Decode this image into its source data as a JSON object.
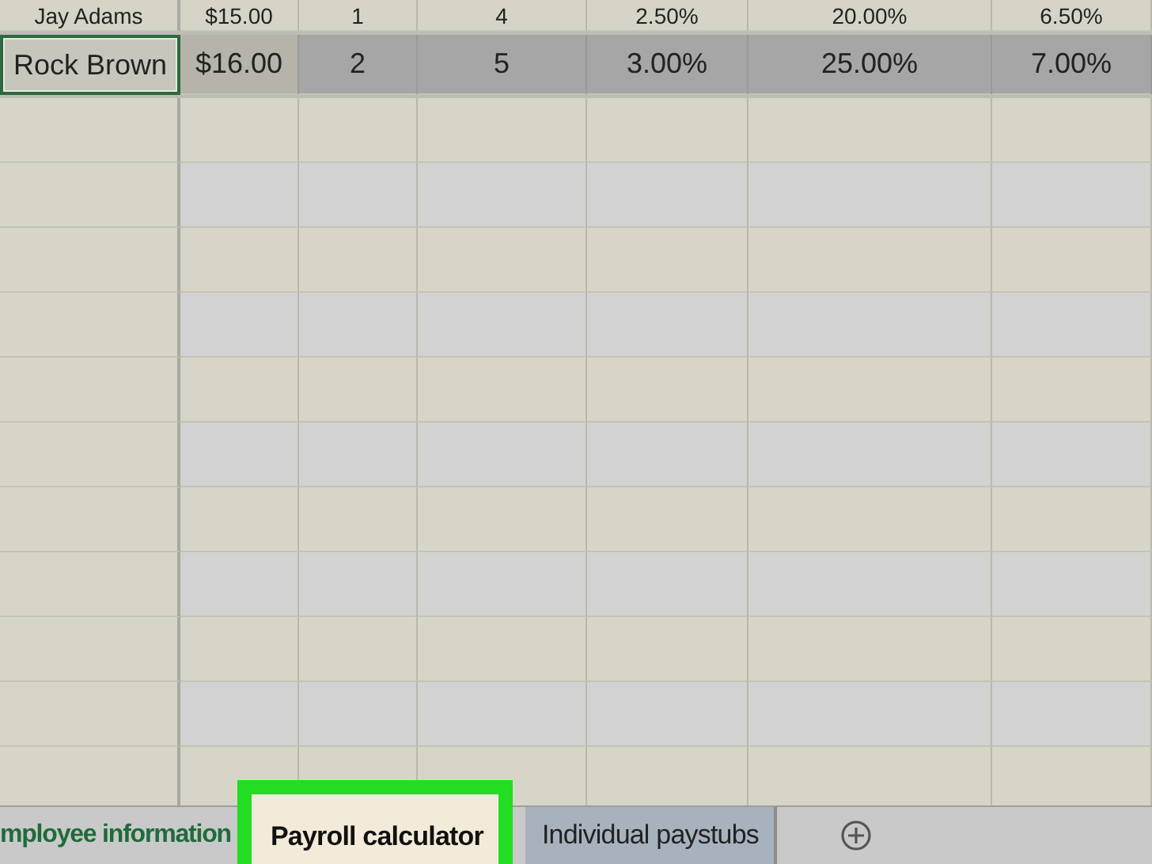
{
  "table": {
    "rows": [
      {
        "selected": false,
        "cells": [
          "Jay Adams",
          "$15.00",
          "1",
          "4",
          "2.50%",
          "20.00%",
          "6.50%"
        ]
      },
      {
        "selected": true,
        "cells": [
          "Rock Brown",
          "$16.00",
          "2",
          "5",
          "3.00%",
          "25.00%",
          "7.00%"
        ]
      }
    ]
  },
  "sheet_tabs": [
    {
      "label": "mployee information",
      "selected": false,
      "highlighted": false
    },
    {
      "label": "Payroll calculator",
      "selected": true,
      "highlighted": true
    },
    {
      "label": "Individual paystubs",
      "selected": false,
      "highlighted": false
    }
  ]
}
